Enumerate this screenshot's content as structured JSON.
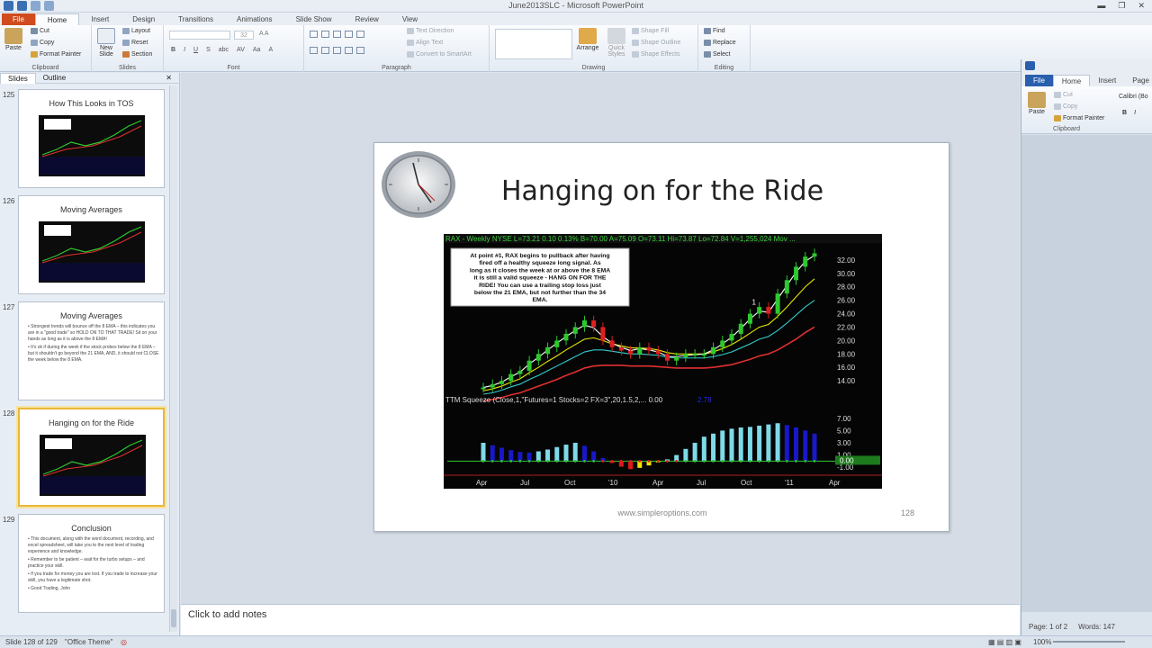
{
  "window": {
    "title": "June2013SLC  -  Microsoft PowerPoint",
    "minimize": "▬",
    "restore": "❐",
    "close": "✕"
  },
  "tabs": [
    "File",
    "Home",
    "Insert",
    "Design",
    "Transitions",
    "Animations",
    "Slide Show",
    "Review",
    "View"
  ],
  "ribbon": {
    "clipboard": {
      "label": "Clipboard",
      "paste": "Paste",
      "cut": "Cut",
      "copy": "Copy",
      "format_painter": "Format Painter"
    },
    "slides": {
      "label": "Slides",
      "new_slide": "New Slide",
      "layout": "Layout",
      "reset": "Reset",
      "section": "Section"
    },
    "font": {
      "label": "Font",
      "size": "32"
    },
    "paragraph": {
      "label": "Paragraph",
      "text_direction": "Text Direction",
      "align_text": "Align Text",
      "convert": "Convert to SmartArt"
    },
    "drawing": {
      "label": "Drawing",
      "arrange": "Arrange",
      "quick_styles": "Quick Styles",
      "shape_fill": "Shape Fill",
      "shape_outline": "Shape Outline",
      "shape_effects": "Shape Effects"
    },
    "editing": {
      "label": "Editing",
      "find": "Find",
      "replace": "Replace",
      "select": "Select"
    }
  },
  "panel_tabs": {
    "slides": "Slides",
    "outline": "Outline"
  },
  "thumbnails": [
    {
      "num": "125",
      "title": "How This Looks in TOS",
      "type": "chart",
      "text": []
    },
    {
      "num": "126",
      "title": "Moving Averages",
      "type": "chart",
      "text": []
    },
    {
      "num": "127",
      "title": "Moving Averages",
      "type": "text",
      "text": [
        "Strongest trends will bounce off the 8 EMA – this indicates you are in a \"good trade\" so HOLD ON TO THAT TRADE! Sit on your hands as long as it is above the 8 EMA!",
        "It's ok if during the week if the stock probes below the 8 EMA – but it shouldn't go beyond the 21 EMA, AND, it should not CLOSE the week below the 8 EMA."
      ]
    },
    {
      "num": "128",
      "title": "Hanging on for the Ride",
      "type": "chart",
      "text": []
    },
    {
      "num": "129",
      "title": "Conclusion",
      "type": "text",
      "text": [
        "This document, along with the word document, recording, and excel spreadsheet, will take you to the next level of trading experience and knowledge.",
        "Remember to be patient – wait for the turbo setups – and practice your skill.",
        "If you trade for money you are lost. If you trade to increase your skill, you have a legitimate shot.",
        "Good Trading, John"
      ]
    }
  ],
  "slide": {
    "title": "Hanging on for the Ride",
    "url": "www.simpleroptions.com",
    "number": "128",
    "chart_header": "RAX - Weekly  NYSE  L=73.21  0.10  0.13%  B=70.00  A=75.09  O=73.11  Hi=73.87  Lo=72.84  V=1,255,024  Mov ...",
    "annotation": "At point #1, RAX begins to pullback after having fired off a healthy squeeze long signal.  As long as it closes the week at or above the 8 EMA it is still a valid squeeze - HANG ON FOR THE RIDE!  You can use a trailing stop loss just below the 21 EMA, but not further than the 34 EMA.",
    "point_label": "1",
    "squeeze_label": "TTM Squeeze (Close,1,\"Futures=1 Stocks=2 FX=3\",20,1.5,2,...  0.00",
    "squeeze_value": "2.78",
    "price_ticks": [
      "32.00",
      "30.00",
      "28.00",
      "26.00",
      "24.00",
      "22.00",
      "20.00",
      "18.00",
      "16.00",
      "14.00"
    ],
    "osc_ticks": [
      "7.00",
      "5.00",
      "3.00",
      "1.00",
      "-1.00"
    ],
    "osc_current": "0.00",
    "x_ticks": [
      "Apr",
      "Jul",
      "Oct",
      "'10",
      "Apr",
      "Jul",
      "Oct",
      "'11",
      "Apr"
    ]
  },
  "chart_data": {
    "type": "line",
    "title": "",
    "x": [
      "Apr",
      "Jul",
      "Oct",
      "'10",
      "Apr",
      "Jul",
      "Oct",
      "'11",
      "Apr"
    ],
    "series": [],
    "price": [
      13,
      13.5,
      14,
      15,
      15.5,
      17,
      18,
      19,
      20,
      21,
      22,
      23,
      22,
      20,
      19,
      18.5,
      18,
      19,
      18.5,
      18,
      17,
      17.5,
      18,
      18,
      18,
      19,
      20,
      21,
      22.5,
      24,
      25,
      24,
      27,
      29,
      31,
      32.5,
      33
    ],
    "ema8": [
      13,
      13.3,
      13.8,
      14.6,
      15.3,
      16.5,
      17.5,
      18.6,
      19.6,
      20.6,
      21.5,
      22.3,
      21.9,
      20.6,
      19.6,
      19,
      18.5,
      18.8,
      18.6,
      18.3,
      17.6,
      17.6,
      17.8,
      17.9,
      18,
      18.6,
      19.5,
      20.5,
      21.8,
      23.2,
      24.4,
      24.2,
      26.2,
      28.2,
      30.2,
      31.8,
      32.7
    ],
    "ema21": [
      12.5,
      12.8,
      13.2,
      13.8,
      14.3,
      15.2,
      16,
      16.9,
      17.7,
      18.6,
      19.4,
      20.2,
      20.4,
      20,
      19.5,
      19.2,
      18.9,
      18.9,
      18.8,
      18.6,
      18.2,
      18,
      18,
      18,
      18,
      18.3,
      18.8,
      19.4,
      20.2,
      21.1,
      22,
      22.4,
      23.6,
      25,
      26.5,
      28,
      29.2
    ],
    "ema34": [
      12,
      12.2,
      12.6,
      13.1,
      13.5,
      14.2,
      14.8,
      15.5,
      16.2,
      16.9,
      17.6,
      18.3,
      18.6,
      18.6,
      18.4,
      18.2,
      18,
      18,
      17.9,
      17.8,
      17.5,
      17.4,
      17.4,
      17.4,
      17.4,
      17.6,
      17.9,
      18.3,
      18.9,
      19.5,
      20.2,
      20.6,
      21.5,
      22.6,
      23.8,
      25,
      26
    ],
    "ema55": [
      11,
      11.2,
      11.5,
      11.9,
      12.2,
      12.7,
      13.2,
      13.7,
      14.2,
      14.8,
      15.3,
      15.9,
      16.2,
      16.3,
      16.3,
      16.3,
      16.2,
      16.2,
      16.2,
      16.1,
      16,
      15.9,
      15.9,
      15.9,
      15.9,
      16,
      16.2,
      16.4,
      16.8,
      17.2,
      17.7,
      18,
      18.6,
      19.4,
      20.2,
      21.2,
      22
    ],
    "squeeze": [
      3,
      2.6,
      2.2,
      1.8,
      1.5,
      1.4,
      1.6,
      1.9,
      2.3,
      2.7,
      3,
      2.5,
      1.6,
      0.5,
      -0.3,
      -0.9,
      -1.3,
      -1.1,
      -0.7,
      -0.2,
      0.3,
      1,
      2,
      3,
      4,
      4.5,
      5,
      5.3,
      5.5,
      5.6,
      5.8,
      6,
      6.2,
      5.9,
      5.5,
      5,
      4.5
    ],
    "price_ylim": [
      12,
      34
    ],
    "osc_ylim": [
      -2,
      8
    ],
    "grid": false,
    "colors": {
      "price_up": "#2ec82e",
      "price_down": "#e02020",
      "ema8": "#ffffff",
      "ema21": "#e6e600",
      "ema34": "#33cccc",
      "ema55": "#e03030",
      "squeeze_pos": "#1818c8",
      "squeeze_pos2": "#7fd9e8",
      "squeeze_neg": "#e01818",
      "squeeze_neg2": "#f5e000"
    }
  },
  "notes": {
    "placeholder": "Click to add notes"
  },
  "status": {
    "slide": "Slide 128 of 129",
    "theme": "\"Office Theme\"",
    "zoom": "100%"
  },
  "word_window": {
    "tabs": [
      "File",
      "Home",
      "Insert",
      "Page"
    ],
    "cut": "Cut",
    "copy": "Copy",
    "paste": "Paste",
    "format_painter": "Format Painter",
    "clipboard": "Clipboard",
    "font": "Calibri (Bo",
    "page": "Page: 1 of 2",
    "words": "Words: 147"
  }
}
